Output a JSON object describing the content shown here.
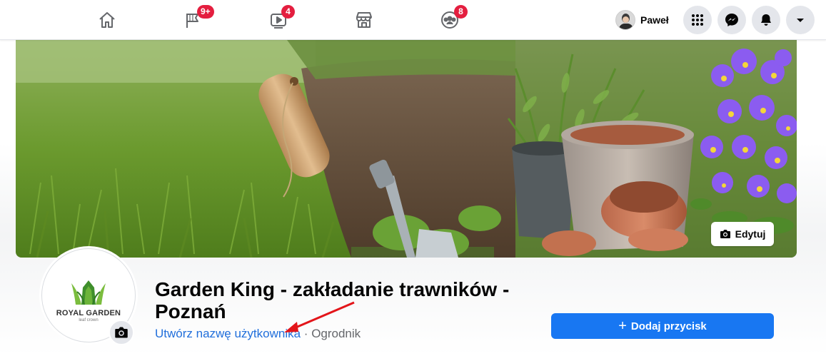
{
  "nav": {
    "tabs": [
      {
        "name": "home-icon",
        "badge": null
      },
      {
        "name": "pages-flag-icon",
        "badge": "9+"
      },
      {
        "name": "watch-video-icon",
        "badge": "4"
      },
      {
        "name": "marketplace-icon",
        "badge": null
      },
      {
        "name": "groups-icon",
        "badge": "8"
      }
    ],
    "profile_name": "Paweł",
    "right_icons": [
      "menu-grid-icon",
      "messenger-icon",
      "notifications-bell-icon",
      "account-dropdown-icon"
    ]
  },
  "cover": {
    "edit_label": "Edytuj"
  },
  "profile_picture": {
    "logo_text": "ROYAL GARDEN",
    "logo_subtext": "leaf crown"
  },
  "page": {
    "title": "Garden King - zakładanie trawników - Poznań",
    "username_link": "Utwórz nazwę użytkownika",
    "separator": " · ",
    "category": "Ogrodnik",
    "add_button_label": "Dodaj przycisk",
    "add_button_plus": "+"
  },
  "colors": {
    "accent": "#1877f2",
    "link": "#216fdb",
    "badge": "#e41e3f",
    "annotation_arrow": "#e3151a"
  }
}
